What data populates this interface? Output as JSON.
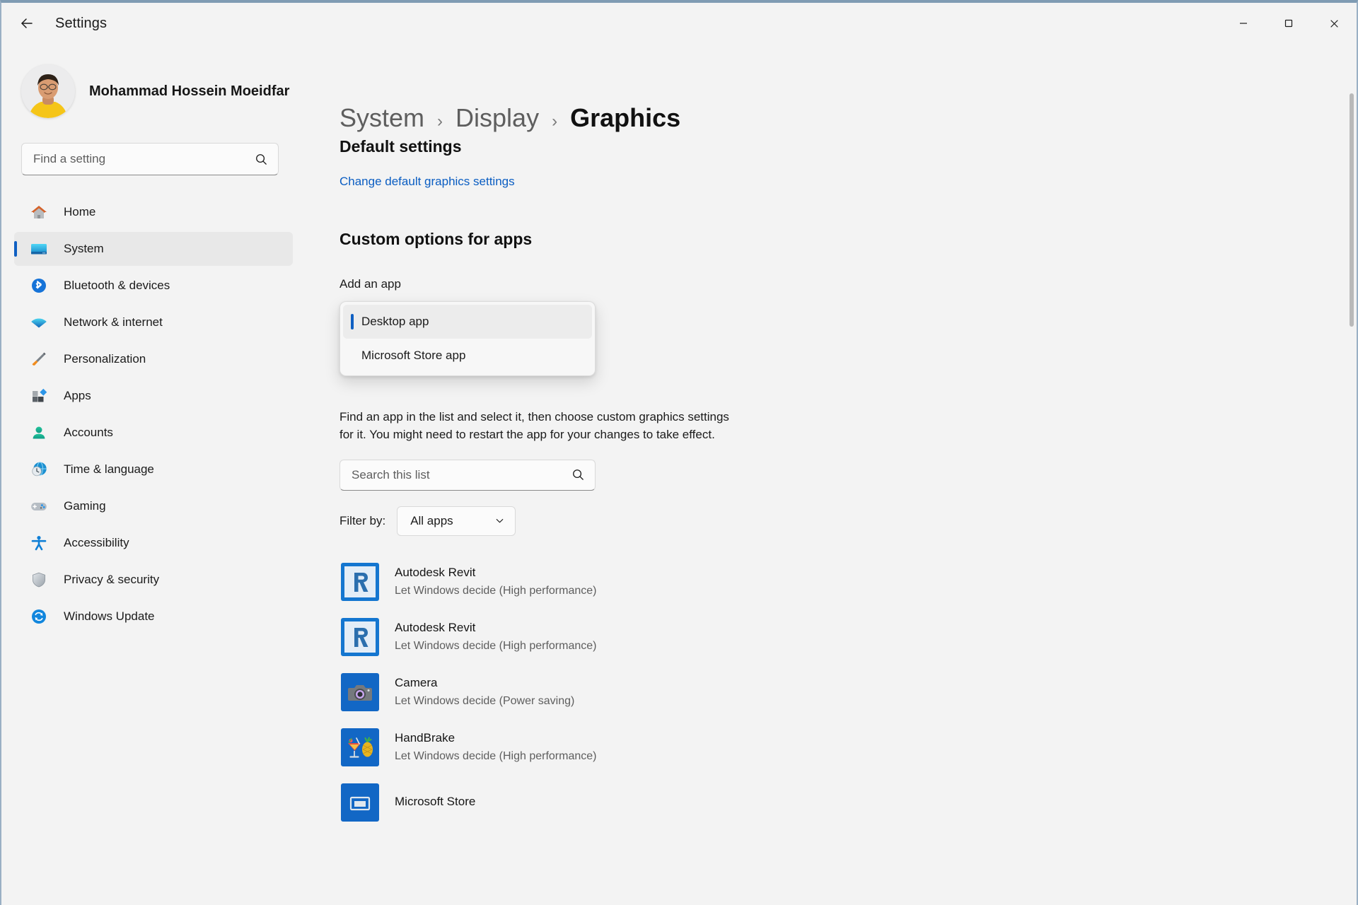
{
  "window": {
    "title": "Settings",
    "back_icon": "back-arrow-icon",
    "controls": {
      "minimize": "minimize-icon",
      "maximize": "maximize-icon",
      "close": "close-icon"
    }
  },
  "sidebar": {
    "account": {
      "name": "Mohammad Hossein Moeidfar"
    },
    "search": {
      "placeholder": "Find a setting",
      "icon": "search-icon"
    },
    "items": [
      {
        "label": "Home",
        "icon": "home-icon",
        "selected": false
      },
      {
        "label": "System",
        "icon": "system-monitor-icon",
        "selected": true
      },
      {
        "label": "Bluetooth & devices",
        "icon": "bluetooth-icon",
        "selected": false
      },
      {
        "label": "Network & internet",
        "icon": "wifi-icon",
        "selected": false
      },
      {
        "label": "Personalization",
        "icon": "paintbrush-icon",
        "selected": false
      },
      {
        "label": "Apps",
        "icon": "apps-icon",
        "selected": false
      },
      {
        "label": "Accounts",
        "icon": "person-icon",
        "selected": false
      },
      {
        "label": "Time & language",
        "icon": "clock-globe-icon",
        "selected": false
      },
      {
        "label": "Gaming",
        "icon": "gamepad-icon",
        "selected": false
      },
      {
        "label": "Accessibility",
        "icon": "accessibility-person-icon",
        "selected": false
      },
      {
        "label": "Privacy & security",
        "icon": "shield-icon",
        "selected": false
      },
      {
        "label": "Windows Update",
        "icon": "update-refresh-icon",
        "selected": false
      }
    ]
  },
  "main": {
    "breadcrumb": [
      {
        "label": "System",
        "current": false
      },
      {
        "label": "Display",
        "current": false
      },
      {
        "label": "Graphics",
        "current": true
      }
    ],
    "breadcrumb_separator": "›",
    "default_settings": {
      "heading": "Default settings",
      "link": "Change default graphics settings"
    },
    "custom_options": {
      "heading": "Custom options for apps",
      "add_app_label": "Add an app",
      "dropdown": {
        "options": [
          {
            "label": "Desktop app",
            "selected": true
          },
          {
            "label": "Microsoft Store app",
            "selected": false
          }
        ]
      },
      "help_text": "Find an app in the list and select it, then choose custom graphics settings for it. You might need to restart the app for your changes to take effect.",
      "list_search": {
        "placeholder": "Search this list",
        "icon": "search-icon"
      },
      "filter": {
        "label": "Filter by:",
        "value": "All apps",
        "chevron": "chevron-down-icon"
      }
    },
    "apps": [
      {
        "name": "Autodesk Revit",
        "status": "Let Windows decide (High performance)",
        "icon": "revit-icon"
      },
      {
        "name": "Autodesk Revit",
        "status": "Let Windows decide (High performance)",
        "icon": "revit-icon"
      },
      {
        "name": "Camera",
        "status": "Let Windows decide (Power saving)",
        "icon": "camera-icon"
      },
      {
        "name": "HandBrake",
        "status": "Let Windows decide (High performance)",
        "icon": "handbrake-icon"
      },
      {
        "name": "Microsoft Store",
        "status": "",
        "icon": "store-icon"
      }
    ]
  },
  "colors": {
    "accent": "#0f5fc2",
    "link": "#0a5dc2",
    "background": "#f3f3f3",
    "text": "#1b1b1b",
    "muted_text": "#5e5e5e"
  }
}
